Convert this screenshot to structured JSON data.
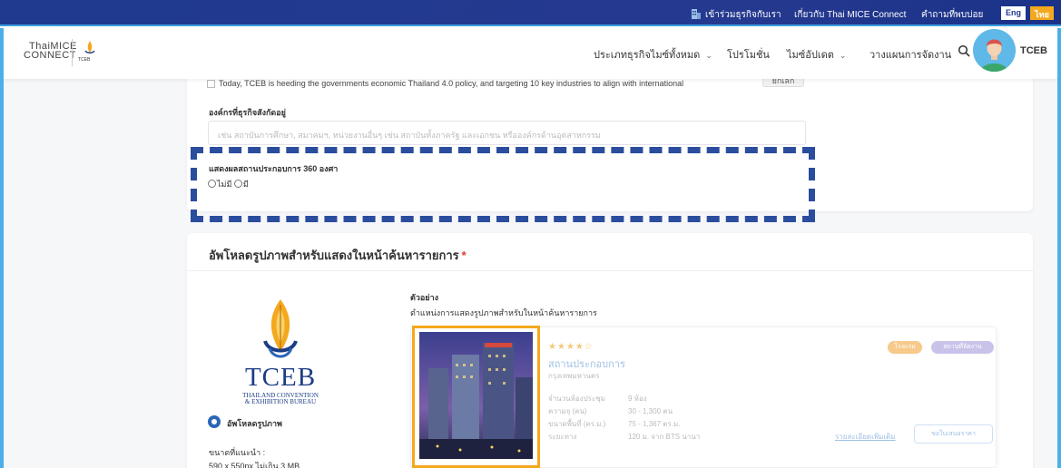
{
  "topbar": {
    "join": "เข้าร่วมธุรกิจกับเรา",
    "about": "เกี่ยวกับ Thai MICE Connect",
    "faq": "คำถามที่พบบ่อย",
    "lang_en": "Eng",
    "lang_th": "ไทย"
  },
  "logo": {
    "line1": "ThaiMICE",
    "line2": "CONNECT",
    "tceb_small": "TCEB"
  },
  "nav": {
    "items": [
      {
        "label": "ประเภทธุรกิจไมซ์ทั้งหมด",
        "has_dropdown": true
      },
      {
        "label": "โปรโมชั่น",
        "has_dropdown": false
      },
      {
        "label": "ไมซ์อัปเดต",
        "has_dropdown": true
      },
      {
        "label": "วางแผนการจัดงาน",
        "has_dropdown": false
      }
    ],
    "user": "TCEB"
  },
  "form": {
    "partial_text": "Today, TCEB is heeding the governments economic Thailand 4.0 policy, and targeting 10 key industries to align with international",
    "partial_button": "ยกเลิก",
    "org_label": "องค์กรที่ธุรกิจสังกัดอยู่",
    "org_placeholder": "เช่น สถาบันการศึกษา, สมาคมฯ, หน่วยงานอื่นๆ เช่น สถาบันทั้งภาครัฐ และเอกชน หรือองค์กรด้านอุตสาหกรรม",
    "r360_label": "แสดงผลสถานประกอบการ 360 องศา",
    "r360_no": "ไม่มี",
    "r360_yes": "มี"
  },
  "upload": {
    "title": "อัพโหลดรูปภาพสำหรับแสดงในหน้าค้นหารายการ",
    "required": "*",
    "tceb_word": "TCEB",
    "tceb_sub1": "THAILAND CONVENTION",
    "tceb_sub2": "& EXHIBITION BUREAU",
    "upload_label": "อัพโหลดรูปภาพ",
    "size_label": "ขนาดที่แนะนำ :",
    "size_value": "590 x 550px ไม่เกิน 3 MB"
  },
  "example": {
    "title": "ตัวอย่าง",
    "desc": "ตำแหน่งการแสดงรูปภาพสำหรับในหน้าค้นหารายการ",
    "stars": "★★★★☆",
    "name": "สถานประกอบการ",
    "location": "กรุงเทพมหานคร",
    "badge_hotel": "โรงแรม",
    "badge_cat": "สถานที่จัดงาน",
    "specs": [
      {
        "label": "จำนวนห้องประชุม",
        "value": "9 ห้อง"
      },
      {
        "label": "ความจุ (คน)",
        "value": "30 - 1,300 คน"
      },
      {
        "label": "ขนาดพื้นที่ (ตร.ม.)",
        "value": "75 - 1,367 ตร.ม."
      },
      {
        "label": "ระยะทาง",
        "value": "120 ม. จาก BTS นานา"
      }
    ],
    "link": "รายละเอียดเพิ่มเติม",
    "button": "ขอใบเสนอราคา"
  },
  "colors": {
    "topbar": "#1f3a8f",
    "accent_orange": "#f4a81d",
    "highlight_dash": "#2b4d9e",
    "edge": "#4bb0e8"
  }
}
